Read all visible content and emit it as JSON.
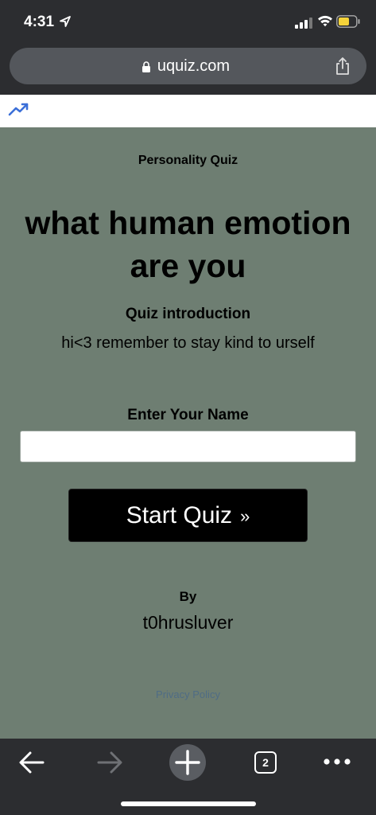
{
  "status_bar": {
    "time": "4:31"
  },
  "browser": {
    "url": "uquiz.com",
    "open_tabs": "2"
  },
  "quiz": {
    "type": "Personality Quiz",
    "title": "what human emotion are you",
    "intro_heading": "Quiz introduction",
    "intro_text": "hi<3 remember to stay kind to urself",
    "name_label": "Enter Your Name",
    "name_value": "",
    "start_label": "Start Quiz",
    "start_arrow": "»",
    "by_label": "By",
    "author": "t0hrusluver",
    "privacy_link": "Privacy Policy"
  },
  "icons": [
    "location-arrow-icon",
    "signal-icon",
    "wifi-icon",
    "battery-icon",
    "lock-icon",
    "share-icon",
    "trending-icon",
    "back-arrow-icon",
    "forward-arrow-icon",
    "plus-icon",
    "tabs-icon",
    "more-icon"
  ],
  "colors": {
    "background": "#6e7e72",
    "browser_chrome": "#2c2d30",
    "button": "#000000",
    "link": "#4f6c85"
  }
}
